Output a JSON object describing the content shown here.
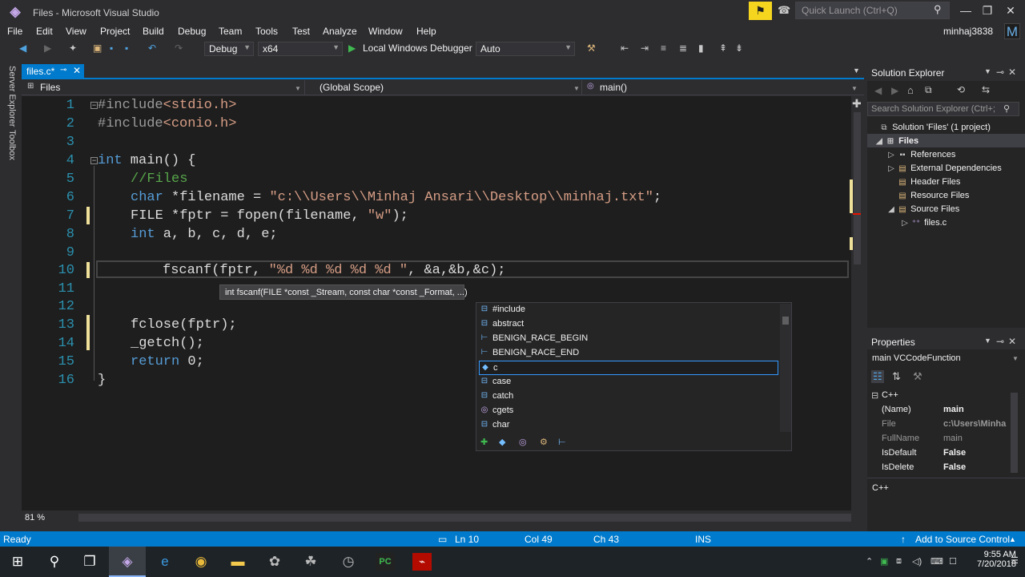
{
  "window": {
    "title": "Files - Microsoft Visual Studio",
    "logo_glyph": "◈"
  },
  "titlebar": {
    "quick_launch_placeholder": "Quick Launch (Ctrl+Q)"
  },
  "menu": [
    "File",
    "Edit",
    "View",
    "Project",
    "Build",
    "Debug",
    "Team",
    "Tools",
    "Test",
    "Analyze",
    "Window",
    "Help"
  ],
  "user": {
    "name": "minhaj3838",
    "avatar_letter": "M"
  },
  "toolbar": {
    "config": "Debug",
    "platform": "x64",
    "run_label": "Local Windows Debugger",
    "run_mode": "Auto"
  },
  "side_strip": {
    "server_explorer": "Server Explorer",
    "toolbox": "Toolbox"
  },
  "doc_tab": {
    "label": "files.c*"
  },
  "nav": {
    "project": "Files",
    "scope": "(Global Scope)",
    "member": "main()"
  },
  "code_lines": [
    {
      "n": "1"
    },
    {
      "n": "2"
    },
    {
      "n": "3"
    },
    {
      "n": "4"
    },
    {
      "n": "5"
    },
    {
      "n": "6"
    },
    {
      "n": "7"
    },
    {
      "n": "8"
    },
    {
      "n": "9"
    },
    {
      "n": "10"
    },
    {
      "n": "11"
    },
    {
      "n": "12"
    },
    {
      "n": "13"
    },
    {
      "n": "14"
    },
    {
      "n": "15"
    },
    {
      "n": "16"
    }
  ],
  "code": {
    "l1_pp": "#include",
    "l1_inc": "<stdio.h>",
    "l2_pp": "#include",
    "l2_inc": "<conio.h>",
    "l4_kw": "int",
    "l4_rest": " main() {",
    "l5": "//Files",
    "l6_kw": "char",
    "l6_mid": " *filename = ",
    "l6_str": "\"c:\\\\Users\\\\Minhaj Ansari\\\\Desktop\\\\minhaj.txt\"",
    "l6_end": ";",
    "l7_a": "FILE *fptr = fopen(filename, ",
    "l7_str": "\"w\"",
    "l7_end": ");",
    "l8_kw": "int",
    "l8_rest": " a, b, c, d, e;",
    "l10_a": "fscanf(fptr, ",
    "l10_str": "\"%d %d %d %d %d \"",
    "l10_end": ", &a,&b,&c);",
    "l13": "fclose(fptr);",
    "l14": "_getch();",
    "l15_kw": "return",
    "l15_rest": " 0;",
    "l16": "}"
  },
  "tooltip": "int fscanf(FILE *const _Stream, const char *const _Format, ...)",
  "intellisense": [
    {
      "label": "#include",
      "icon": "keyword-icon"
    },
    {
      "label": "abstract",
      "icon": "keyword-icon"
    },
    {
      "label": "BENIGN_RACE_BEGIN",
      "icon": "macro-icon"
    },
    {
      "label": "BENIGN_RACE_END",
      "icon": "macro-icon"
    },
    {
      "label": "c",
      "icon": "variable-icon",
      "selected": true
    },
    {
      "label": "case",
      "icon": "keyword-icon"
    },
    {
      "label": "catch",
      "icon": "keyword-icon"
    },
    {
      "label": "cgets",
      "icon": "function-icon"
    },
    {
      "label": "char",
      "icon": "keyword-icon"
    }
  ],
  "zoom": "81 %",
  "solution_explorer": {
    "title": "Solution Explorer",
    "search_placeholder": "Search Solution Explorer (Ctrl+;",
    "tree": [
      {
        "label": "Solution 'Files' (1 project)"
      },
      {
        "label": "Files"
      },
      {
        "label": "References"
      },
      {
        "label": "External Dependencies"
      },
      {
        "label": "Header Files"
      },
      {
        "label": "Resource Files"
      },
      {
        "label": "Source Files"
      },
      {
        "label": "files.c"
      }
    ]
  },
  "properties": {
    "title": "Properties",
    "object": "main  VCCodeFunction",
    "category": "C++",
    "rows": [
      {
        "name": "(Name)",
        "value": "main"
      },
      {
        "name": "File",
        "value": "c:\\Users\\Minha"
      },
      {
        "name": "FullName",
        "value": "main"
      },
      {
        "name": "IsDefault",
        "value": "False"
      },
      {
        "name": "IsDelete",
        "value": "False"
      }
    ],
    "footer": "C++"
  },
  "status": {
    "ready": "Ready",
    "ln": "Ln 10",
    "col": "Col 49",
    "ch": "Ch 43",
    "ins": "INS",
    "source_control": "Add to Source Control"
  },
  "clock": {
    "time": "9:55 AM",
    "date": "7/20/2018"
  }
}
